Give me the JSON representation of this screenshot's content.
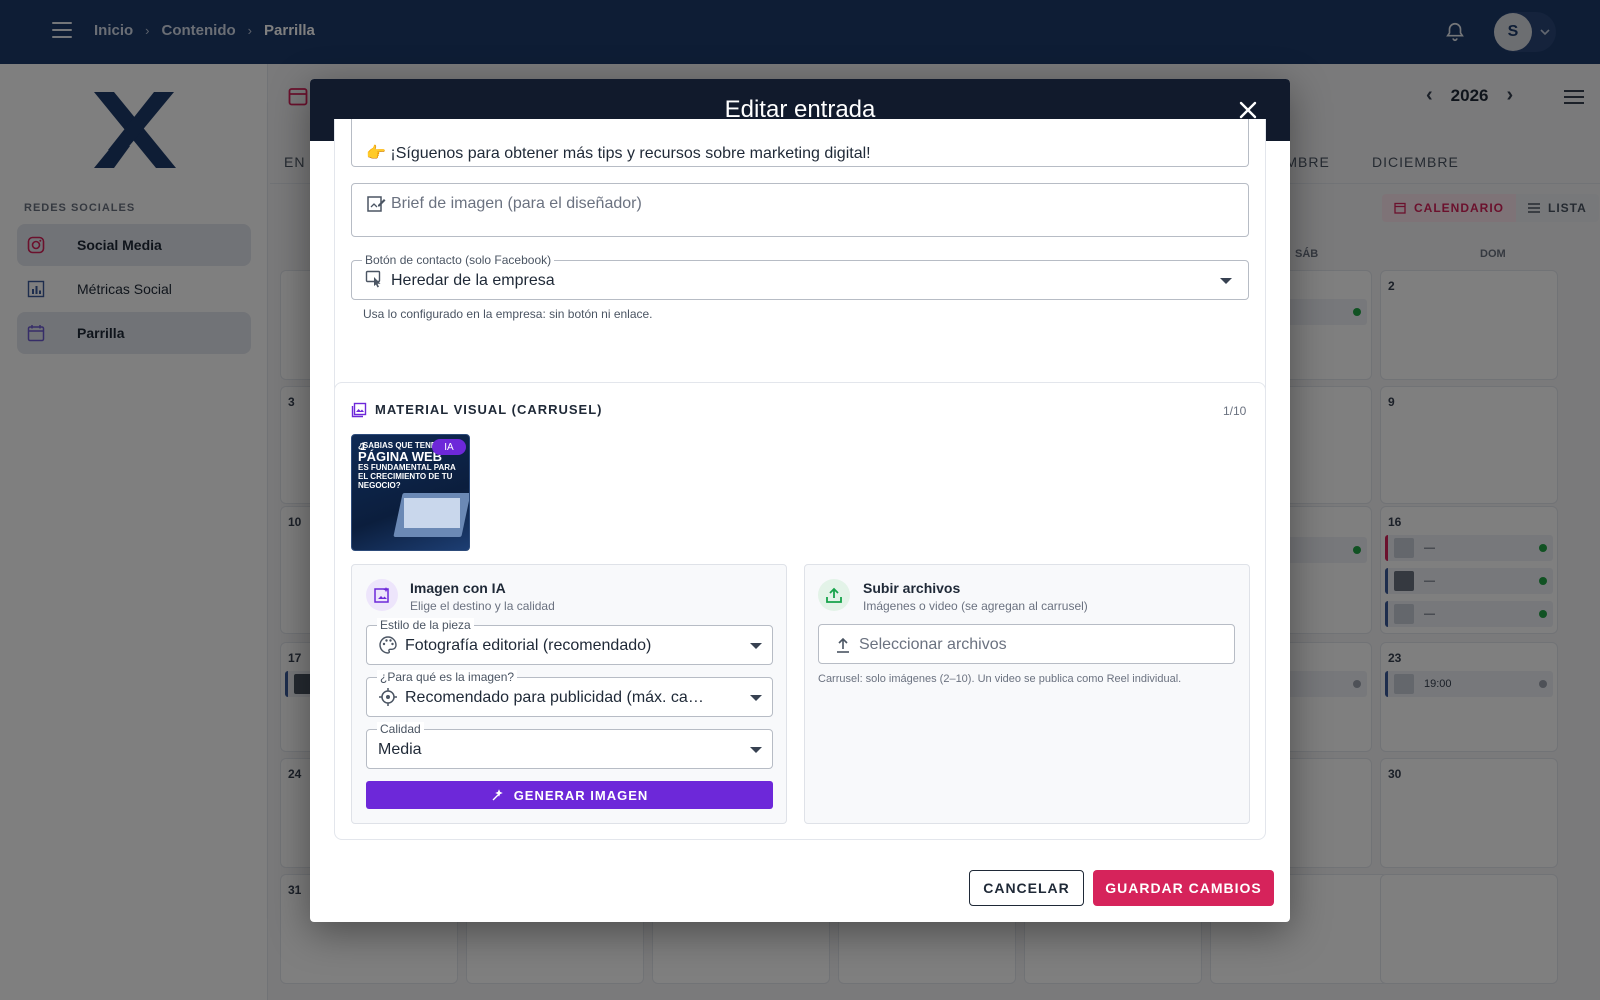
{
  "topbar": {
    "breadcrumb": [
      "Inicio",
      "Contenido",
      "Parrilla"
    ],
    "avatar_initial": "S"
  },
  "sidebar": {
    "section_title": "REDES SOCIALES",
    "items": [
      {
        "label": "Social Media",
        "icon": "instagram-icon",
        "active": true
      },
      {
        "label": "Métricas Social",
        "icon": "bar-chart-icon",
        "active": false
      },
      {
        "label": "Parrilla",
        "icon": "calendar-icon",
        "active": true
      }
    ]
  },
  "calendar": {
    "year": "2026",
    "months_visible": [
      "EN",
      "EMBRE",
      "DICIEMBRE"
    ],
    "view_toggle": {
      "calendar": "CALENDARIO",
      "list": "LISTA"
    },
    "weekdays_visible": [
      "SÁB",
      "DOM"
    ],
    "day_numbers": [
      "2",
      "3",
      "9",
      "10",
      "16",
      "17",
      "23",
      "24",
      "30",
      "31"
    ],
    "event_time": "19:00",
    "event_placeholder": "—"
  },
  "modal": {
    "title": "Editar entrada",
    "text_line": "👉 ¡Síguenos para obtener más tips y recursos sobre marketing digital!",
    "brief_placeholder": "Brief de imagen (para el diseñador)",
    "contact_button": {
      "label": "Botón de contacto (solo Facebook)",
      "value": "Heredar de la empresa",
      "helper": "Usa lo configurado en la empresa: sin botón ni enlace."
    },
    "visual_section": {
      "title": "MATERIAL VISUAL (CARRUSEL)",
      "counter": "1/10",
      "thumbnail": {
        "index": "1",
        "badge": "IA",
        "text_small": "¿SABIAS QUE TENER",
        "text_big": "PÁGINA WEB",
        "text_rest": "ES FUNDAMENTAL PARA EL CRECIMIENTO DE TU NEGOCIO?"
      }
    },
    "ai_block": {
      "title": "Imagen con IA",
      "subtitle": "Elige el destino y la calidad",
      "style_label": "Estilo de la pieza",
      "style_value": "Fotografía editorial (recomendado)",
      "purpose_label": "¿Para qué es la imagen?",
      "purpose_value": "Recomendado para publicidad (máx. calidad)",
      "quality_label": "Calidad",
      "quality_value": "Media",
      "generate_button": "GENERAR IMAGEN"
    },
    "upload_block": {
      "title": "Subir archivos",
      "subtitle": "Imágenes o video (se agregan al carrusel)",
      "select_placeholder": "Seleccionar archivos",
      "note": "Carrusel: solo imágenes (2–10). Un video se publica como Reel individual."
    },
    "footer": {
      "cancel": "CANCELAR",
      "save": "GUARDAR CAMBIOS"
    }
  },
  "colors": {
    "topbar": "#1c3a6b",
    "accent_pink": "#d6235b",
    "accent_purple": "#6d28d9",
    "modal_header": "#111a2c",
    "upload_green": "#16a34a"
  }
}
